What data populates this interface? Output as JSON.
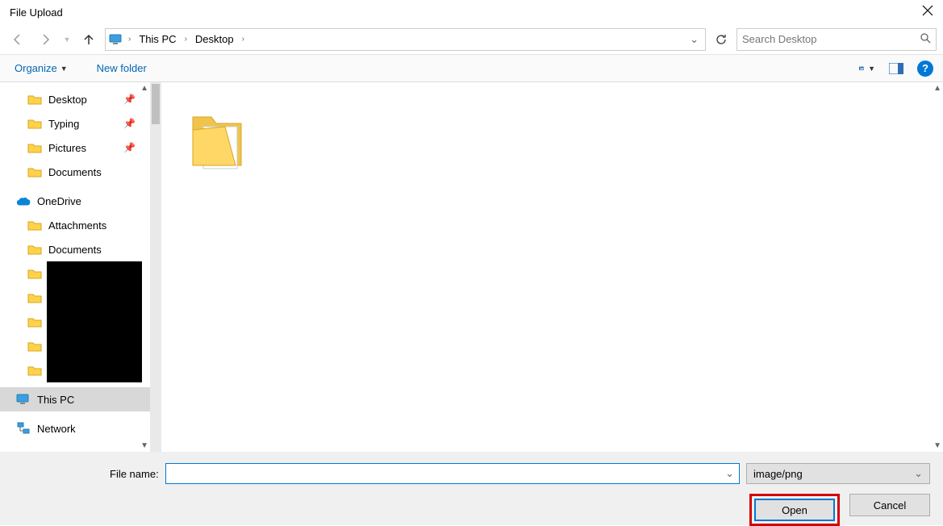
{
  "title": "File Upload",
  "breadcrumb": {
    "root": "This PC",
    "folder": "Desktop"
  },
  "search": {
    "placeholder": "Search Desktop"
  },
  "toolbar": {
    "organize": "Organize",
    "newfolder": "New folder"
  },
  "nav": {
    "items": [
      {
        "label": "Desktop",
        "pinned": true
      },
      {
        "label": "Typing",
        "pinned": true
      },
      {
        "label": "Pictures",
        "pinned": true
      },
      {
        "label": "Documents",
        "pinned": false
      }
    ],
    "onedrive": "OneDrive",
    "od_items": [
      {
        "label": "Attachments"
      },
      {
        "label": "Documents"
      }
    ],
    "thispc": "This PC",
    "network": "Network"
  },
  "content": {
    "folder_name": ""
  },
  "footer": {
    "filename_label": "File name:",
    "filename_value": "",
    "filter": "image/png",
    "open": "Open",
    "cancel": "Cancel"
  }
}
